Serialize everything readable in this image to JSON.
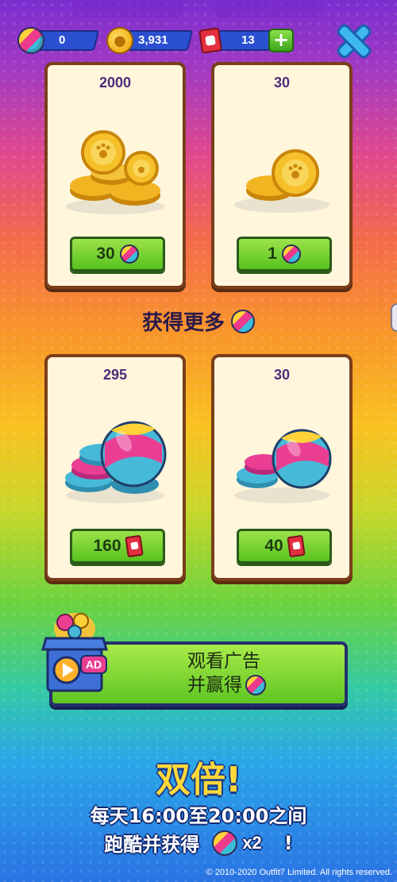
{
  "topbar": {
    "gems": "0",
    "coins": "3,931",
    "tickets": "13",
    "add_label": "+",
    "icons": {
      "gems": "gem-icon",
      "coins": "coin-icon",
      "tickets": "ticket-icon",
      "close": "close-icon"
    }
  },
  "offers": [
    {
      "amount": "2000",
      "price": "30",
      "currency": "gem",
      "art": "coin-pile"
    },
    {
      "amount": "30",
      "price": "1",
      "currency": "gem",
      "art": "coin-small"
    },
    {
      "amount": "295",
      "price": "160",
      "currency": "ticket",
      "art": "gem-stack"
    },
    {
      "amount": "30",
      "price": "40",
      "currency": "ticket",
      "art": "gem-small"
    }
  ],
  "get_more": {
    "label": "获得更多"
  },
  "ad": {
    "line1": "观看广告",
    "line2": "并赢得",
    "badge": "AD"
  },
  "promo": {
    "title": "双倍!",
    "line1": "每天16:00至20:00之间",
    "line2_prefix": "跑酷并获得",
    "multiplier": "x2",
    "line2_suffix": "!"
  },
  "copyright": "© 2010-2020 Outfit7 Limited. All rights reserved.",
  "colors": {
    "card_bg": "#fff6dc",
    "card_border": "#7a3e1b",
    "button_green": "#58c21f",
    "amount_text": "#4b2d7a",
    "promo_yellow": "#ffd93a"
  }
}
